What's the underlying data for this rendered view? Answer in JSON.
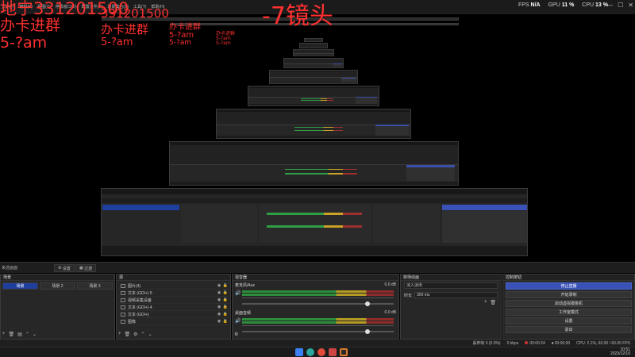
{
  "titlebar": {
    "menu": [
      "文件(F)",
      "编辑(E)",
      "视图(V)",
      "停靠窗口(D)",
      "配置文件(P)",
      "场景集合(S)",
      "工具(T)",
      "帮助(H)"
    ],
    "stats": {
      "fps_label": "FPS",
      "fps_value": "N/A",
      "gpu_label": "GPU",
      "gpu_value": "11 %",
      "cpu_label": "CPU",
      "cpu_value": "13 %"
    },
    "window_buttons": [
      "—",
      "☐",
      "✕"
    ]
  },
  "overlays": {
    "large": {
      "line1": "地宁331201500",
      "line2": "办卡进群",
      "line3": "5-?am"
    },
    "medium": {
      "line1": "331201500",
      "line2": "办卡进群",
      "line3": "5-?am"
    },
    "small": {
      "line1": "办卡进群",
      "line2": "5-?am",
      "line3": "5-?am"
    },
    "tiny": {
      "line1": "办卡进群",
      "line2": "5-?am",
      "line3": "5-?am"
    },
    "big_title": "-7镜头"
  },
  "scene_bar": {
    "label": "来选画面",
    "btn_settings": "设置",
    "btn_transition": "过渡"
  },
  "scenes": {
    "header": "场景",
    "tabs": [
      {
        "label": "场景"
      },
      {
        "label": "场景 2"
      },
      {
        "label": "场景 3"
      }
    ]
  },
  "sources": {
    "header": "源",
    "items": [
      {
        "name": "图片(4)"
      },
      {
        "name": "文本 (GDI+) 5"
      },
      {
        "name": "视频采集设备"
      },
      {
        "name": "文本 (GDI+) 4"
      },
      {
        "name": "文本 (GDI+)"
      },
      {
        "name": "图像"
      }
    ]
  },
  "mixer": {
    "header": "混音器",
    "tracks": [
      {
        "name": "麦克风/Aux",
        "db": "0.0 dB"
      },
      {
        "name": "桌面音频",
        "db": "0.0 dB"
      }
    ]
  },
  "transitions": {
    "header": "转场动画",
    "type": "淡入淡出",
    "duration_label": "时长",
    "duration": "300 ms"
  },
  "controls": {
    "header": "控制按钮",
    "buttons": [
      "停止直播",
      "开始录制",
      "启动虚拟摄像机",
      "工作室模式",
      "设置",
      "退出"
    ]
  },
  "status": {
    "dropped": "丢弃帧 0 (0.0%)",
    "live": "00:00:24",
    "rec": "00:00:00",
    "cpu": "CPU: 2.1%, 60.00 / 60.00 FPS",
    "bitrate": "0 kbps"
  },
  "taskbar": {
    "time": "10:51",
    "date": "2023/12/16",
    "icons": [
      "windows-icon",
      "edge-icon",
      "chrome-icon",
      "app-icon",
      "obs-icon"
    ]
  },
  "colors": {
    "accent": "#3a52b8",
    "overlay": "#ff3030"
  }
}
